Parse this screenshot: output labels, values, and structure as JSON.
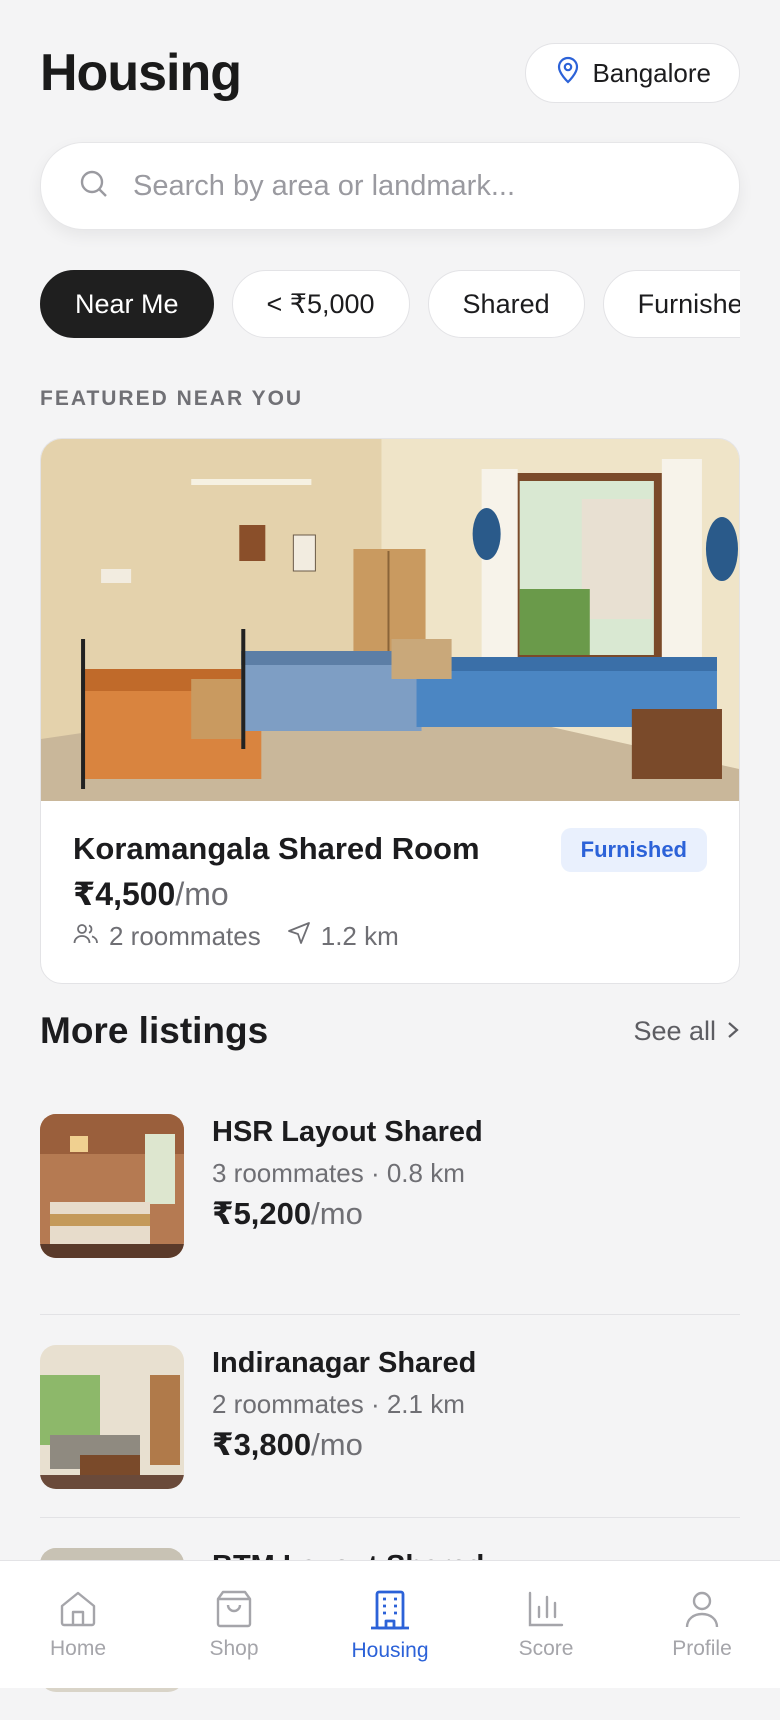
{
  "header": {
    "title": "Housing",
    "location": "Bangalore"
  },
  "search": {
    "placeholder": "Search by area or landmark..."
  },
  "filters": [
    "Near Me",
    "< ₹5,000",
    "Shared",
    "Furnished"
  ],
  "featured": {
    "section_label": "FEATURED NEAR YOU",
    "title": "Koramangala Shared Room",
    "badge": "Furnished",
    "price": "₹4,500",
    "price_unit": "/mo",
    "roommates": "2 roommates",
    "distance": "1.2 km"
  },
  "more": {
    "title": "More listings",
    "see_all": "See all"
  },
  "listings": [
    {
      "title": "HSR Layout Shared",
      "meta": "3 roommates · 0.8 km",
      "price": "₹5,200",
      "unit": "/mo"
    },
    {
      "title": "Indiranagar Shared",
      "meta": "2 roommates · 2.1 km",
      "price": "₹3,800",
      "unit": "/mo"
    },
    {
      "title": "BTM Layout Shared"
    }
  ],
  "tabs": [
    {
      "label": "Home",
      "icon": "home-icon"
    },
    {
      "label": "Shop",
      "icon": "bag-icon"
    },
    {
      "label": "Housing",
      "icon": "building-icon",
      "active": true
    },
    {
      "label": "Score",
      "icon": "bar-chart-icon"
    },
    {
      "label": "Profile",
      "icon": "user-icon"
    }
  ],
  "colors": {
    "accent": "#2c62d8",
    "active_chip": "#1f1f1f",
    "badge_bg": "#e9f0fd",
    "background": "#f4f4f5"
  }
}
